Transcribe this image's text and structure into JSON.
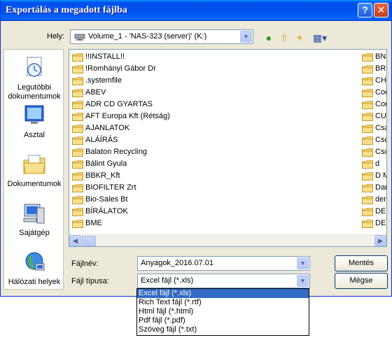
{
  "window": {
    "title": "Exportálás a megadott fájlba"
  },
  "lookin": {
    "label": "Hely:",
    "value": "Volume_1 - 'NAS-323 (server)' (K:)"
  },
  "places": [
    {
      "label": "Legutóbbi dokumentumok"
    },
    {
      "label": "Asztal"
    },
    {
      "label": "Dokumentumok"
    },
    {
      "label": "Sajátgép"
    },
    {
      "label": "Hálózati helyek"
    }
  ],
  "files_col1": [
    "!!INSTALL!!",
    "!Romhányi Gábor Dr",
    ".systemfile",
    "ABEV",
    "ADR CD GYARTAS",
    "AFT Europa Kft (Rétság)",
    "AJANLATOK",
    "ALÁÍRÁS",
    "Balaton Recycling",
    "Bálint Gyula",
    "BBKR_Kft",
    "BIOFILTER Zrt",
    "Bio-Sales Bt",
    "BÍRÁLATOK",
    "BME"
  ],
  "files_col2": [
    "BNI",
    "BRO",
    "CHS",
    "Coc",
    "Cor",
    "CUI",
    "Csa",
    "Csc",
    "Csc",
    "d",
    "D M",
    "Dan",
    "der",
    "DEF",
    "DES"
  ],
  "filename": {
    "label": "Fájlnév:",
    "value": "Anyagok_2016.07.01"
  },
  "filetype": {
    "label": "Fájl típusa:",
    "value": "Excel fájl (*.xls)",
    "options": [
      "Excel fájl (*.xls)",
      "Rich Text fájl (*.rtf)",
      "Html fájl (*.html)",
      "Pdf fájl (*.pdf)",
      "Szöveg fájl (*.txt)"
    ]
  },
  "buttons": {
    "save": "Mentés",
    "cancel": "Mégse"
  },
  "colors": {
    "titlebar": "#0054e3",
    "selection": "#316ac5",
    "folder": "#f5d67a"
  }
}
